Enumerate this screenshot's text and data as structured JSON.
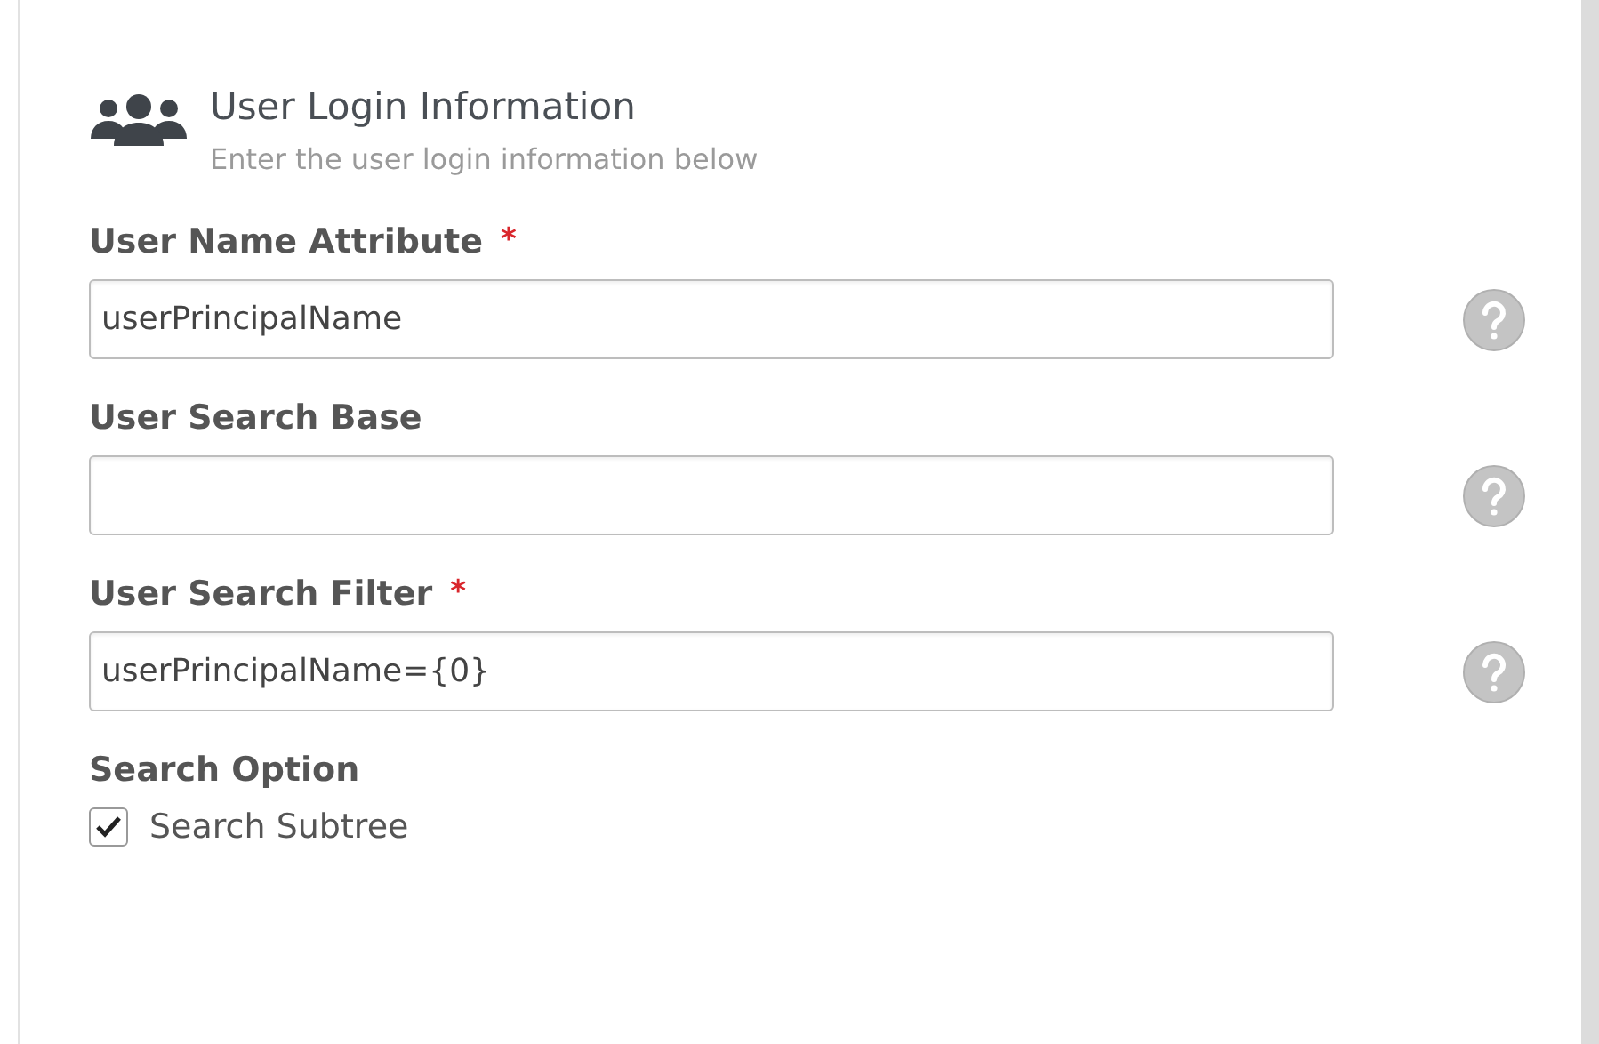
{
  "section": {
    "title": "User Login Information",
    "subtitle": "Enter the user login information below"
  },
  "fields": [
    {
      "label": "User Name Attribute",
      "required": true,
      "value": "userPrincipalName"
    },
    {
      "label": "User Search Base",
      "required": false
    },
    {
      "label": "User Search Filter",
      "required": true,
      "value": "userPrincipalName={0}"
    }
  ],
  "required_mark": "*",
  "search_option": {
    "label": "Search Option",
    "options": [
      {
        "label": "Search Subtree",
        "checked": true
      }
    ]
  }
}
